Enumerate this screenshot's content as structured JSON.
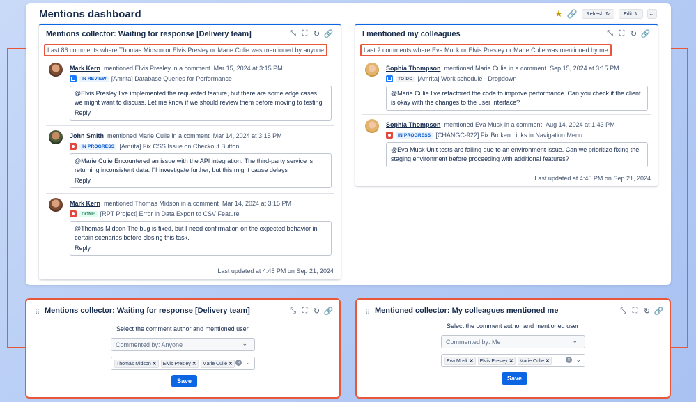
{
  "dashboard": {
    "title": "Mentions dashboard",
    "refresh_label": "Refresh",
    "edit_label": "Edit",
    "more_label": "···"
  },
  "left_gadget": {
    "title": "Mentions collector: Waiting for response [Delivery team]",
    "subtitle": "Last 86 comments where Thomas Midson or Elvis Presley or Marie Culie was mentioned by anyone",
    "entries": [
      {
        "author": "Mark Kern",
        "action": "mentioned Elvis Presley in a comment",
        "date": "Mar 15, 2024 at 3:15 PM",
        "status": "IN REVIEW",
        "issue": "[Amrita] Database Queries for Performance",
        "comment": "@Elvis Presley I've implemented the requested feature, but there are some edge cases we might want to discuss. Let me know if we should review them before moving to testing",
        "reply": "Reply"
      },
      {
        "author": "John Smith",
        "action": "mentioned Marie Culie in a comment",
        "date": "Mar 14, 2024 at 3:15 PM",
        "status": "IN PROGRESS",
        "issue": "[Amrita] Fix CSS Issue on Checkout Button",
        "comment": "@Marie Culie Encountered an issue with the API integration. The third-party service is returning inconsistent data. I'll investigate further, but this might cause delays",
        "reply": "Reply"
      },
      {
        "author": "Mark Kern",
        "action": "mentioned Thomas Midson in a comment",
        "date": "Mar 14, 2024 at 3:15 PM",
        "status": "DONE",
        "issue": "[RPT Project] Error in Data Export to CSV Feature",
        "comment": "@Thomas Midson The bug is fixed, but I need confirmation on the expected behavior in certain scenarios before closing this task.",
        "reply": "Reply"
      }
    ],
    "updated": "Last updated at 4:45 PM on Sep 21, 2024"
  },
  "right_gadget": {
    "title": "I mentioned my colleagues",
    "subtitle": "Last 2 comments where Eva Muck or Elvis Presley or Marie Culie was mentioned by me",
    "entries": [
      {
        "author": "Sophia Thompson",
        "action": "mentioned Marie Culie in a comment",
        "date": "Sep 15, 2024 at 3:15 PM",
        "status": "TO DO",
        "issue": "[Amrita] Work schedule - Dropdown",
        "comment": "@Marie Culie I've refactored the code to improve performance. Can you check if the client is okay with the changes to the user interface?"
      },
      {
        "author": "Sophia Thompson",
        "action": "mentioned Eva Musk in a comment",
        "date": "Aug 14, 2024 at 1:43 PM",
        "status": "IN PROGRESS",
        "issue": "[CHANGC-922] Fix Broken Links in Navigation Menu",
        "comment": "@Eva Musk Unit tests are failing due to an environment issue. Can we prioritize fixing the staging environment before proceeding with additional features?"
      }
    ],
    "updated": "Last updated at 4:45 PM on Sep 21, 2024"
  },
  "left_config": {
    "title": "Mentions collector: Waiting for response [Delivery team]",
    "prompt": "Select the comment author and mentioned user",
    "commented_by": "Commented by: Anyone",
    "users": [
      "Thomas Midson",
      "Elvis Presley",
      "Marie Culie"
    ],
    "save_label": "Save"
  },
  "right_config": {
    "title": "Mentioned collector: My colleagues mentioned me",
    "prompt": "Select the comment author and mentioned user",
    "commented_by": "Commented by: Me",
    "users": [
      "Eva Musk",
      "Elvis Presley",
      "Marie Culie"
    ],
    "save_label": "Save"
  },
  "colors": {
    "accent": "#0c66e4",
    "highlight": "#e8573a"
  }
}
